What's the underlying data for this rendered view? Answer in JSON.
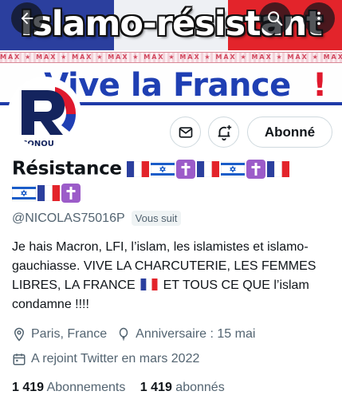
{
  "banner": {
    "title": "Islamo-résistant",
    "vive_text": "Vive la France",
    "vive_bang": "!",
    "stamp_text": "MAX ★ MAX ★ MAX ★ MAX ★ MAX ★ MAX ★ MAX ★ MAX ★ MAX ★ MAX ★ MAX",
    "colors": {
      "blue": "#2b3f9e",
      "white": "#eef0f4",
      "red": "#e3242b"
    }
  },
  "header_icons": [
    "back-arrow-icon",
    "search-icon",
    "more-vertical-icon"
  ],
  "avatar": {
    "label": "CONOU",
    "letter": "R"
  },
  "actions": {
    "message_icon": "mail-icon",
    "notify_icon": "bell-plus-icon",
    "follow_label": "Abonné"
  },
  "profile": {
    "name": "Résistance",
    "handle": "@NICOLAS75016P",
    "follows_you": "Vous suit",
    "bio_part1": "Je hais Macron, LFI, l’islam, les islamistes et islamo-gauchiasse. VIVE LA CHARCUTERIE, LES FEMMES LIBRES, LA FRANCE",
    "bio_part2": "ET TOUS CE QUE l’islam condamne !!!!",
    "location": "Paris, France",
    "birthday": "Anniversaire : 15 mai",
    "joined": "A rejoint Twitter en mars 2022"
  },
  "stats": {
    "following_count": "1 419",
    "following_label": "Abonnements",
    "followers_count": "1 419",
    "followers_label": "abonnés"
  },
  "accent": "#1d9bf0"
}
